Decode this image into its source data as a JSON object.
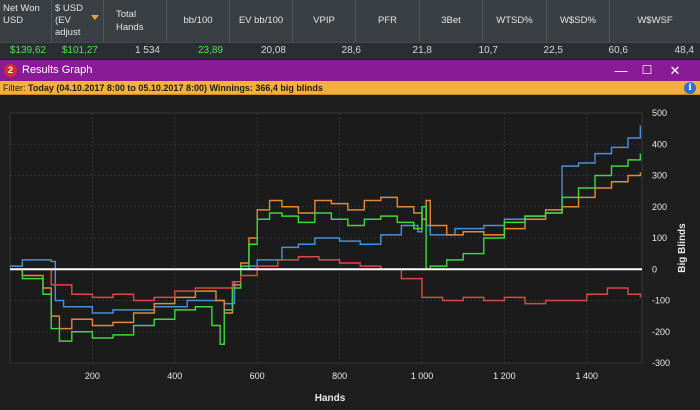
{
  "stats": {
    "headers": [
      "Net Won USD",
      "$ USD (EV adjust",
      "Total Hands",
      "bb/100",
      "EV bb/100",
      "VPIP",
      "PFR",
      "3Bet",
      "WTSD%",
      "W$SD%",
      "W$WSF"
    ],
    "values": [
      "$139,62",
      "$101,27",
      "1 534",
      "23,89",
      "20,08",
      "28,6",
      "21,8",
      "10,7",
      "22,5",
      "60,6",
      "48,4"
    ]
  },
  "window": {
    "icon_label": "2",
    "title": "Results Graph",
    "minimize": "—",
    "maximize": "☐",
    "close": "✕"
  },
  "filter": {
    "prefix": "Filter: ",
    "range": "Today (04.10.2017 8:00 to 05.10.2017 8:00)",
    "winnings": " Winnings: 366,4 big blinds",
    "info": "i"
  },
  "colors": {
    "green": "#3fd63f",
    "orange": "#e08a3c",
    "blue": "#4a90d9",
    "red": "#d84a4a",
    "zero_line": "#ffffff"
  },
  "chart_data": {
    "type": "line",
    "xlabel": "Hands",
    "ylabel": "Big Blinds",
    "xlim": [
      0,
      1534
    ],
    "ylim": [
      -300,
      500
    ],
    "xticks": [
      200,
      400,
      600,
      800,
      1000,
      1200,
      1400
    ],
    "xtick_labels": [
      "200",
      "400",
      "600",
      "800",
      "1 000",
      "1 200",
      "1 400"
    ],
    "yticks": [
      -300,
      -200,
      -100,
      0,
      100,
      200,
      300,
      400,
      500
    ],
    "series": [
      {
        "color": "blue",
        "x": [
          0,
          30,
          100,
          110,
          130,
          200,
          250,
          350,
          430,
          520,
          545,
          560,
          580,
          600,
          660,
          700,
          740,
          800,
          850,
          900,
          950,
          990,
          1000,
          1010,
          1020,
          1080,
          1150,
          1200,
          1250,
          1300,
          1340,
          1380,
          1420,
          1460,
          1500,
          1530
        ],
        "y": [
          10,
          30,
          25,
          -100,
          -120,
          -140,
          -130,
          -120,
          -100,
          -110,
          -40,
          0,
          10,
          30,
          70,
          80,
          100,
          90,
          80,
          110,
          140,
          120,
          200,
          140,
          110,
          130,
          140,
          160,
          170,
          180,
          330,
          340,
          370,
          390,
          420,
          460
        ]
      },
      {
        "color": "orange",
        "x": [
          0,
          30,
          80,
          100,
          120,
          150,
          200,
          250,
          300,
          350,
          400,
          450,
          500,
          520,
          540,
          560,
          580,
          600,
          630,
          660,
          700,
          740,
          780,
          820,
          860,
          900,
          940,
          980,
          1000,
          1010,
          1020,
          1060,
          1100,
          1150,
          1200,
          1250,
          1300,
          1340,
          1380,
          1420,
          1460,
          1500,
          1530
        ],
        "y": [
          0,
          -20,
          -60,
          -150,
          -190,
          -160,
          -180,
          -170,
          -140,
          -110,
          -90,
          -70,
          -100,
          -140,
          -50,
          20,
          100,
          190,
          220,
          200,
          180,
          220,
          210,
          190,
          220,
          230,
          200,
          180,
          160,
          220,
          140,
          110,
          120,
          110,
          130,
          160,
          190,
          200,
          230,
          260,
          280,
          300,
          310
        ]
      },
      {
        "color": "green",
        "x": [
          0,
          30,
          80,
          100,
          120,
          150,
          200,
          250,
          300,
          350,
          400,
          450,
          490,
          510,
          520,
          540,
          560,
          580,
          600,
          630,
          660,
          700,
          740,
          780,
          820,
          860,
          900,
          940,
          980,
          1000,
          1010,
          1020,
          1060,
          1100,
          1150,
          1200,
          1250,
          1300,
          1340,
          1380,
          1420,
          1460,
          1500,
          1530
        ],
        "y": [
          0,
          -30,
          -80,
          -190,
          -230,
          -200,
          -220,
          -210,
          -180,
          -160,
          -130,
          -120,
          -180,
          -240,
          -130,
          -60,
          10,
          80,
          160,
          180,
          170,
          150,
          180,
          160,
          140,
          160,
          170,
          150,
          130,
          200,
          0,
          10,
          30,
          50,
          100,
          150,
          170,
          180,
          230,
          260,
          300,
          330,
          350,
          370
        ]
      },
      {
        "color": "red",
        "x": [
          0,
          50,
          100,
          150,
          200,
          250,
          300,
          350,
          400,
          450,
          500,
          540,
          560,
          600,
          650,
          700,
          750,
          800,
          850,
          900,
          950,
          1000,
          1050,
          1100,
          1150,
          1200,
          1250,
          1300,
          1350,
          1400,
          1450,
          1500,
          1530
        ],
        "y": [
          0,
          0,
          -50,
          -80,
          -90,
          -80,
          -100,
          -90,
          -70,
          -60,
          -60,
          -40,
          -20,
          10,
          30,
          40,
          30,
          20,
          10,
          0,
          -30,
          -90,
          -100,
          -90,
          -100,
          -90,
          -110,
          -100,
          -100,
          -80,
          -60,
          -80,
          -90
        ]
      }
    ]
  }
}
